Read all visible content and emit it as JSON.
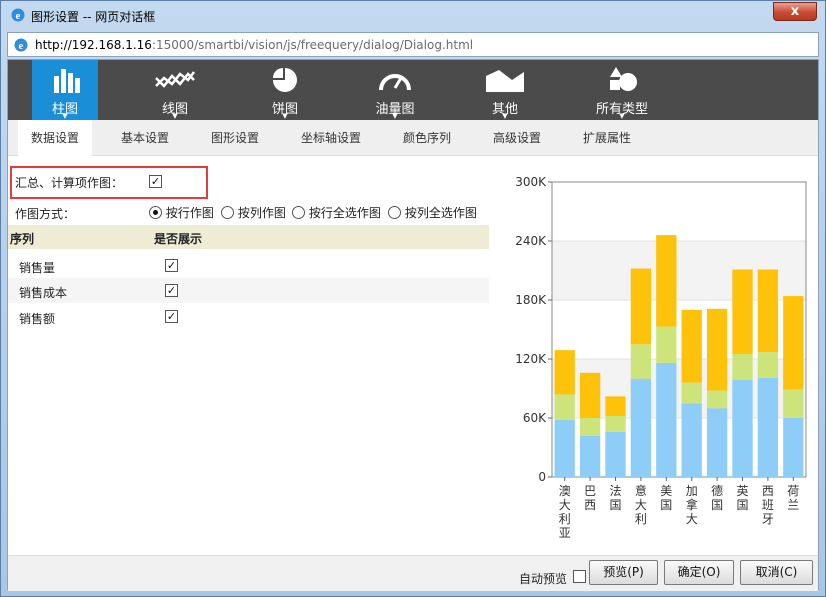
{
  "window": {
    "title": "图形设置 -- 网页对话框",
    "close": "x",
    "url_host": "http://192.168.1.16",
    "url_rest": ":15000/smartbi/vision/js/freequery/dialog/Dialog.html"
  },
  "chart_types": [
    {
      "label": "柱图",
      "icon": "bar-chart-icon",
      "active": true
    },
    {
      "label": "线图",
      "icon": "line-chart-icon"
    },
    {
      "label": "饼图",
      "icon": "pie-chart-icon"
    },
    {
      "label": "油量图",
      "icon": "gauge-icon"
    },
    {
      "label": "其他",
      "icon": "area-chart-icon"
    },
    {
      "label": "所有类型",
      "icon": "all-types-icon"
    }
  ],
  "tabs": [
    "数据设置",
    "基本设置",
    "图形设置",
    "坐标轴设置",
    "颜色序列",
    "高级设置",
    "扩展属性"
  ],
  "summary": {
    "label": "汇总、计算项作图：",
    "checked": "✓"
  },
  "mode": {
    "label": "作图方式：",
    "options": [
      "按行作图",
      "按列作图",
      "按行全选作图",
      "按列全选作图"
    ],
    "selected": "按行作图"
  },
  "series_table": {
    "headers": [
      "序列",
      "是否展示"
    ],
    "rows": [
      {
        "name": "销售量",
        "checked": "✓"
      },
      {
        "name": "销售成本",
        "checked": "✓"
      },
      {
        "name": "销售额",
        "checked": "✓"
      }
    ]
  },
  "chart_data": {
    "type": "bar",
    "stacked": true,
    "categories": [
      "澳大利亚",
      "巴西",
      "法国",
      "意大利",
      "美国",
      "加拿大",
      "德国",
      "英国",
      "西班牙",
      "荷兰"
    ],
    "series": [
      {
        "color": "#8ecdf8",
        "values": [
          58000,
          42000,
          46000,
          100000,
          116000,
          75000,
          70000,
          99000,
          101000,
          60000
        ]
      },
      {
        "color": "#cde47a",
        "values": [
          26000,
          18000,
          16000,
          35000,
          37000,
          21000,
          18000,
          26000,
          26000,
          29000
        ]
      },
      {
        "color": "#fec20b",
        "values": [
          45000,
          46000,
          20000,
          77000,
          93000,
          74000,
          83000,
          86000,
          84000,
          95000
        ]
      }
    ],
    "y_ticks": [
      "0",
      "60K",
      "120K",
      "180K",
      "240K",
      "300K"
    ],
    "ylim": [
      0,
      300000
    ],
    "grid": true
  },
  "footer": {
    "autopreview_label": "自动预览",
    "preview": "预览(P)",
    "ok": "确定(O)",
    "cancel": "取消(C)"
  }
}
